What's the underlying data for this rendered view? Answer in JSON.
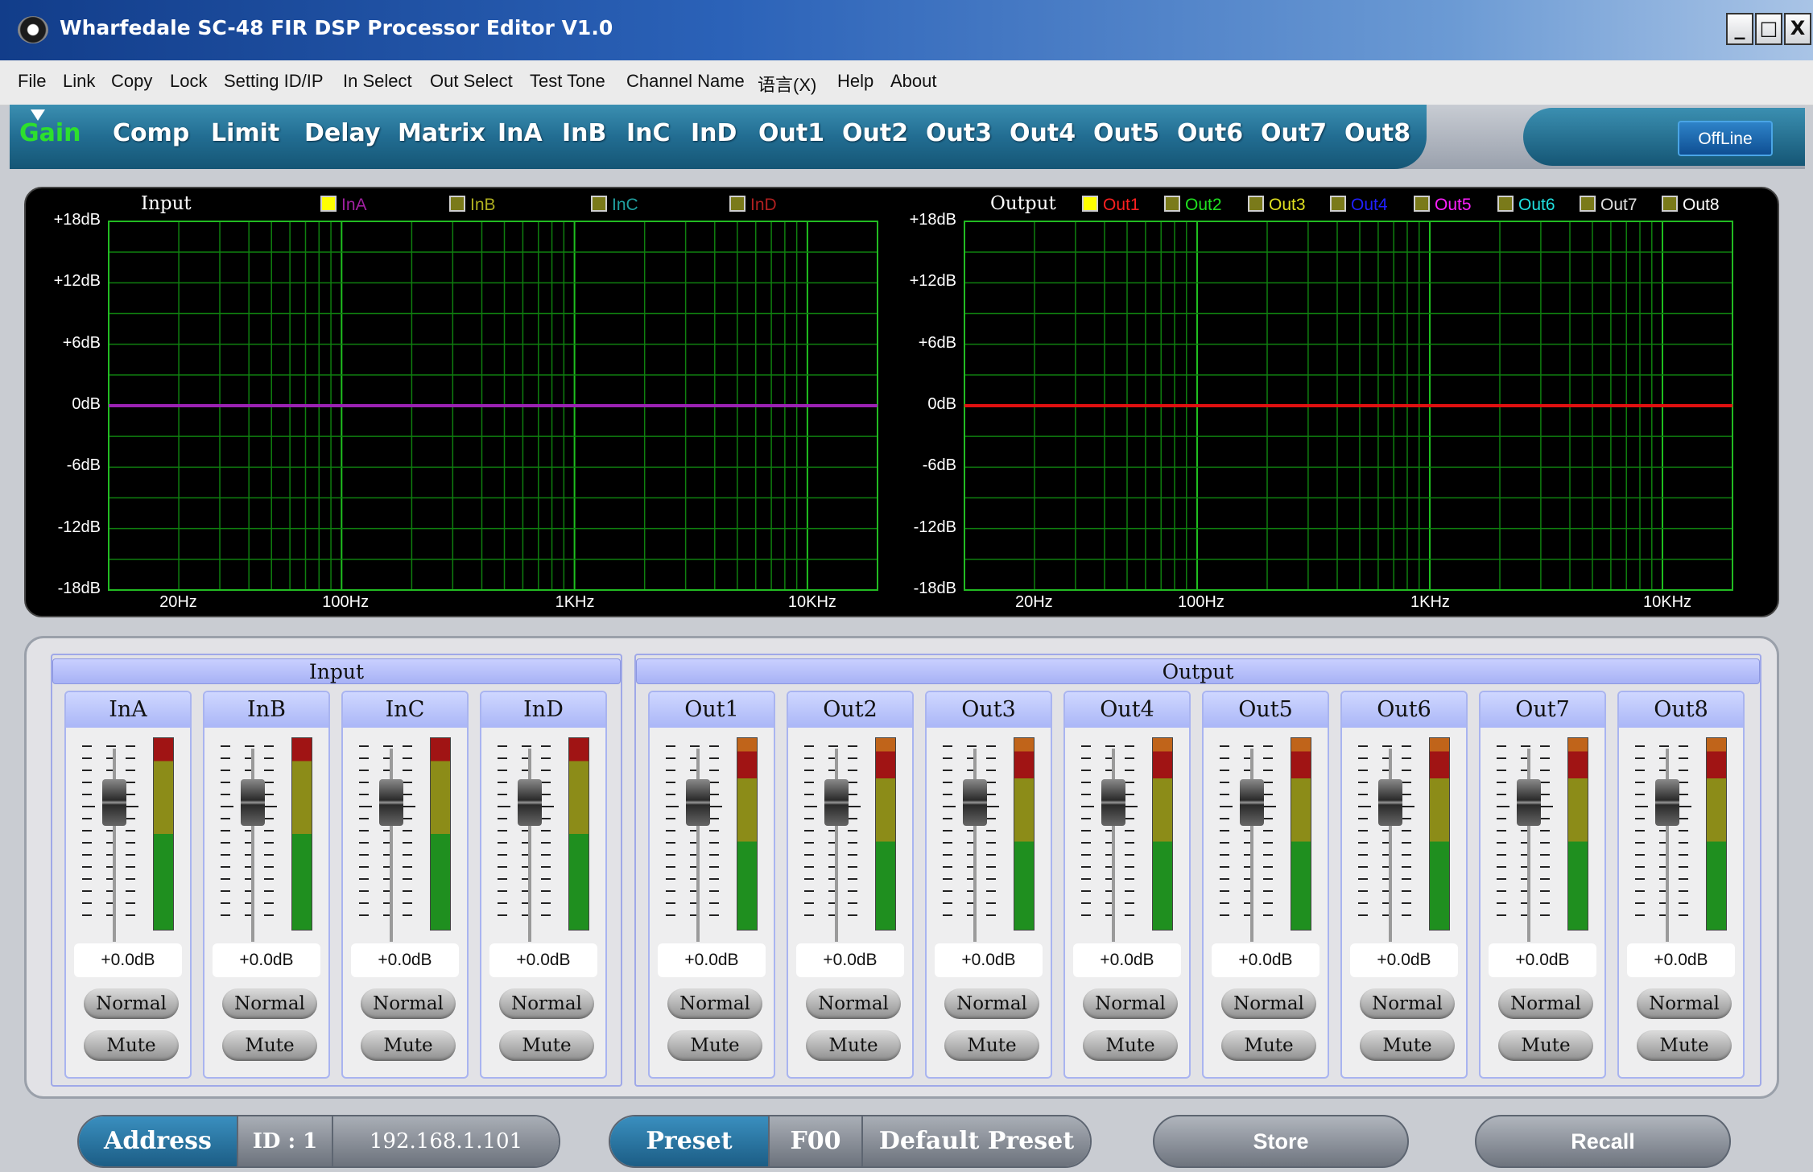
{
  "window": {
    "title": "Wharfedale SC-48 FIR DSP Processor Editor V1.0",
    "minimize": "_",
    "maximize": "□",
    "close": "X"
  },
  "menu": [
    "File",
    "Link",
    "Copy",
    "Lock",
    "Setting ID/IP",
    "In Select",
    "Out Select",
    "Test Tone",
    "Channel Name",
    "语言(X)",
    "Help",
    "About"
  ],
  "tabs": [
    "Gain",
    "Comp",
    "Limit",
    "Delay",
    "Matrix",
    "InA",
    "InB",
    "InC",
    "InD",
    "Out1",
    "Out2",
    "Out3",
    "Out4",
    "Out5",
    "Out6",
    "Out7",
    "Out8"
  ],
  "active_tab": "Gain",
  "status": "OffLine",
  "graphs": {
    "input": {
      "title": "Input",
      "legend": [
        {
          "name": "InA",
          "color": "#a020a0",
          "checked": true
        },
        {
          "name": "InB",
          "color": "#b0b020",
          "checked": false
        },
        {
          "name": "InC",
          "color": "#20a0a0",
          "checked": false
        },
        {
          "name": "InD",
          "color": "#b02020",
          "checked": false
        }
      ],
      "line_color": "#9b22b3"
    },
    "output": {
      "title": "Output",
      "legend": [
        {
          "name": "Out1",
          "color": "#ff2020",
          "checked": true
        },
        {
          "name": "Out2",
          "color": "#20e020",
          "checked": false
        },
        {
          "name": "Out3",
          "color": "#e0e020",
          "checked": false
        },
        {
          "name": "Out4",
          "color": "#2020ff",
          "checked": false
        },
        {
          "name": "Out5",
          "color": "#ff20ff",
          "checked": false
        },
        {
          "name": "Out6",
          "color": "#20e0e0",
          "checked": false
        },
        {
          "name": "Out7",
          "color": "#e0e0e0",
          "checked": false
        },
        {
          "name": "Out8",
          "color": "#ffffff",
          "checked": false
        }
      ],
      "line_color": "#e01010"
    },
    "y_labels": [
      "+18dB",
      "+12dB",
      "+6dB",
      "0dB",
      "-6dB",
      "-12dB",
      "-18dB"
    ],
    "x_labels": [
      "20Hz",
      "100Hz",
      "1KHz",
      "10KHz"
    ]
  },
  "chart_data": {
    "type": "line",
    "x_scale": "log",
    "xlim": [
      10,
      20000
    ],
    "ylim": [
      -18,
      18
    ],
    "series": [
      {
        "name": "InA",
        "x": [
          10,
          20000
        ],
        "y": [
          0,
          0
        ]
      },
      {
        "name": "Out1",
        "x": [
          10,
          20000
        ],
        "y": [
          0,
          0
        ]
      }
    ]
  },
  "mixer": {
    "input_header": "Input",
    "output_header": "Output",
    "channels": [
      {
        "name": "InA",
        "gain": "+0.0dB",
        "mode": "Normal",
        "mute": "Mute"
      },
      {
        "name": "InB",
        "gain": "+0.0dB",
        "mode": "Normal",
        "mute": "Mute"
      },
      {
        "name": "InC",
        "gain": "+0.0dB",
        "mode": "Normal",
        "mute": "Mute"
      },
      {
        "name": "InD",
        "gain": "+0.0dB",
        "mode": "Normal",
        "mute": "Mute"
      },
      {
        "name": "Out1",
        "gain": "+0.0dB",
        "mode": "Normal",
        "mute": "Mute"
      },
      {
        "name": "Out2",
        "gain": "+0.0dB",
        "mode": "Normal",
        "mute": "Mute"
      },
      {
        "name": "Out3",
        "gain": "+0.0dB",
        "mode": "Normal",
        "mute": "Mute"
      },
      {
        "name": "Out4",
        "gain": "+0.0dB",
        "mode": "Normal",
        "mute": "Mute"
      },
      {
        "name": "Out5",
        "gain": "+0.0dB",
        "mode": "Normal",
        "mute": "Mute"
      },
      {
        "name": "Out6",
        "gain": "+0.0dB",
        "mode": "Normal",
        "mute": "Mute"
      },
      {
        "name": "Out7",
        "gain": "+0.0dB",
        "mode": "Normal",
        "mute": "Mute"
      },
      {
        "name": "Out8",
        "gain": "+0.0dB",
        "mode": "Normal",
        "mute": "Mute"
      }
    ]
  },
  "footer": {
    "address_label": "Address",
    "id": "ID : 1",
    "ip": "192.168.1.101",
    "preset_label": "Preset",
    "preset_code": "F00",
    "preset_name": "Default Preset",
    "store": "Store",
    "recall": "Recall"
  }
}
